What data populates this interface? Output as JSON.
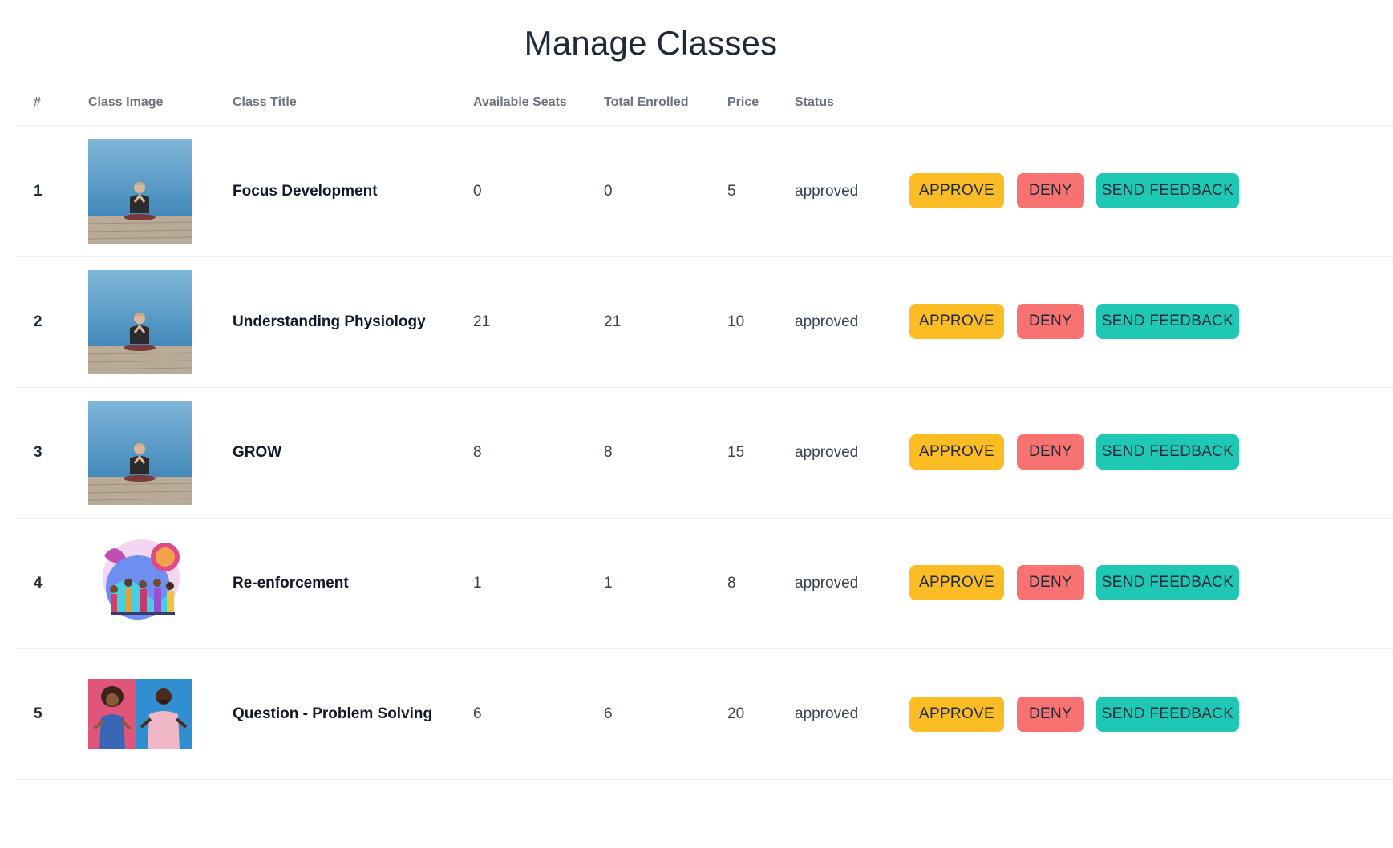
{
  "page": {
    "title": "Manage Classes"
  },
  "colors": {
    "approve": "#fbbd23",
    "deny": "#f87272",
    "feedback": "#1fc7b5"
  },
  "table": {
    "headers": {
      "num": "#",
      "image": "Class Image",
      "title": "Class Title",
      "seats": "Available Seats",
      "enrolled": "Total Enrolled",
      "price": "Price",
      "status": "Status"
    },
    "rows": [
      {
        "num": "1",
        "image": "meditation-photo",
        "title": "Focus Development",
        "seats": "0",
        "enrolled": "0",
        "price": "5",
        "status": "approved",
        "approve": "APPROVE",
        "deny": "DENY",
        "feedback": "SEND FEEDBACK"
      },
      {
        "num": "2",
        "image": "meditation-photo",
        "title": "Understanding Physiology",
        "seats": "21",
        "enrolled": "21",
        "price": "10",
        "status": "approved",
        "approve": "APPROVE",
        "deny": "DENY",
        "feedback": "SEND FEEDBACK"
      },
      {
        "num": "3",
        "image": "meditation-photo",
        "title": "GROW",
        "seats": "8",
        "enrolled": "8",
        "price": "15",
        "status": "approved",
        "approve": "APPROVE",
        "deny": "DENY",
        "feedback": "SEND FEEDBACK"
      },
      {
        "num": "4",
        "image": "global-team-illustration",
        "title": "Re-enforcement",
        "seats": "1",
        "enrolled": "1",
        "price": "8",
        "status": "approved",
        "approve": "APPROVE",
        "deny": "DENY",
        "feedback": "SEND FEEDBACK"
      },
      {
        "num": "5",
        "image": "shrugging-people-photo",
        "title": "Question - Problem Solving",
        "seats": "6",
        "enrolled": "6",
        "price": "20",
        "status": "approved",
        "approve": "APPROVE",
        "deny": "DENY",
        "feedback": "SEND FEEDBACK"
      }
    ]
  }
}
